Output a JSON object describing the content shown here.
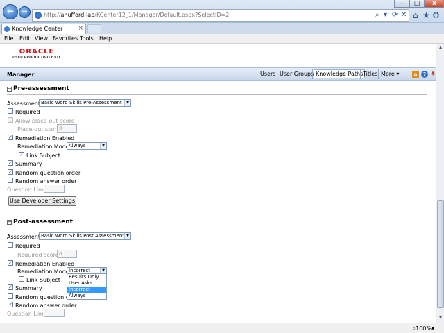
{
  "browser": {
    "url_prefix": "http://",
    "url_host": "ahufford-lap",
    "url_path": "/KCenter12_1/Manager/Default.aspx?SelectID=2",
    "tab_title": "Knowledge Center",
    "tab_close": "×",
    "menu": [
      "File",
      "Edit",
      "View",
      "Favorites",
      "Tools",
      "Help"
    ],
    "back": "←",
    "forward": "→",
    "win": {
      "min": "–",
      "max": "□",
      "close": "x"
    },
    "addr_tools": [
      "⌕",
      "▾",
      "⟳",
      "✕"
    ],
    "chrome_icons": {
      "home": "⌂",
      "favorites": "★",
      "tools": "⚙"
    },
    "zoom": "100%",
    "zoom_caret": "▾"
  },
  "logo": {
    "name": "ORACLE",
    "sub": "USER PRODUCTIVITY KIT"
  },
  "header": {
    "title": "Manager",
    "nav": [
      "Users",
      "User Groups",
      "Knowledge Paths",
      "Titles",
      "More ▾"
    ],
    "icons": {
      "home": "⌂",
      "help": "?",
      "options": "♠"
    }
  },
  "pre": {
    "collapse": "−",
    "heading": "Pre-assessment",
    "assessment_label": "Assessment:",
    "assessment_value": "Basic Word Skills Pre-Assessment",
    "required": "Required",
    "allow_placeout": "Allow place-out score",
    "placeout_label": "Place-out score:",
    "placeout_value": "0",
    "remediation_enabled": "Remediation Enabled",
    "modes_label": "Remediation Modes:",
    "modes_value": "Always",
    "link_subject": "Link Subject",
    "summary": "Summary",
    "random_question": "Random question order",
    "random_answer": "Random answer order",
    "question_limit": "Question Limit:",
    "dev_button": "Use Developer Settings",
    "check": "✓"
  },
  "post": {
    "collapse": "−",
    "heading": "Post-assessment",
    "assessment_label": "Assessment:",
    "assessment_value": "Basic Word Skills Post Assessment",
    "required": "Required",
    "required_score_label": "Required score:",
    "required_score_value": "0",
    "remediation_enabled": "Remediation Enabled",
    "modes_label": "Remediation Modes:",
    "modes_value": "Incorrect",
    "modes_options": [
      "Results Only",
      "User Asks",
      "Incorrect",
      "Always"
    ],
    "link_subject": "Link Subject",
    "summary": "Summary",
    "random_question": "Random question order",
    "random_answer": "Random answer order",
    "question_limit": "Question Limit:",
    "check": "✓"
  },
  "scroll": {
    "up": "▲",
    "down": "▼"
  }
}
